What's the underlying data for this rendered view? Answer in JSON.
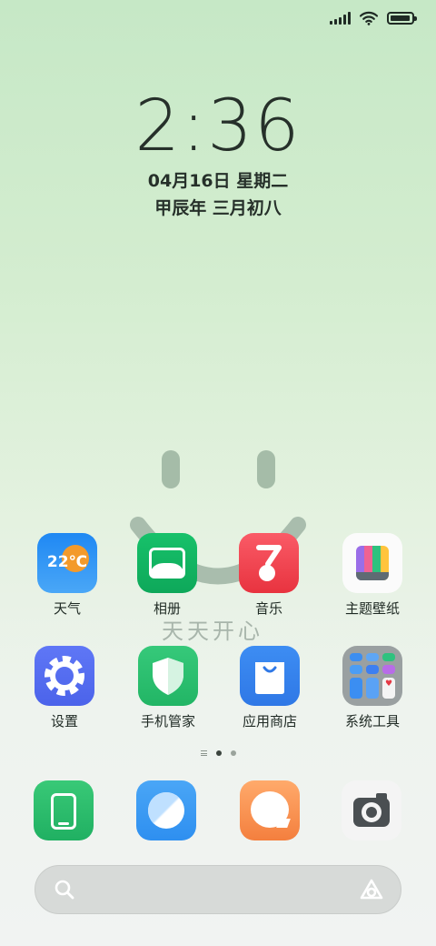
{
  "status": {
    "signal_bars": 5,
    "wifi": "wifi-icon",
    "battery_level": 0.95
  },
  "clock": {
    "time": "2:36",
    "date": "04月16日 星期二",
    "lunar": "甲辰年 三月初八"
  },
  "wallpaper": {
    "text": "天天开心"
  },
  "apps": [
    {
      "label": "天气",
      "icon": "weather-icon",
      "temp": "22℃"
    },
    {
      "label": "相册",
      "icon": "gallery-icon"
    },
    {
      "label": "音乐",
      "icon": "music-icon"
    },
    {
      "label": "主题壁纸",
      "icon": "theme-icon"
    },
    {
      "label": "设置",
      "icon": "settings-icon"
    },
    {
      "label": "手机管家",
      "icon": "phone-manager-icon"
    },
    {
      "label": "应用商店",
      "icon": "app-store-icon"
    },
    {
      "label": "系统工具",
      "icon": "system-tools-folder-icon"
    }
  ],
  "pages": {
    "total": 2,
    "current": 1
  },
  "dock": [
    "phone-icon",
    "browser-icon",
    "messages-icon",
    "camera-icon"
  ],
  "search": {
    "left_icon": "search-icon",
    "right_icon": "assistant-icon"
  }
}
